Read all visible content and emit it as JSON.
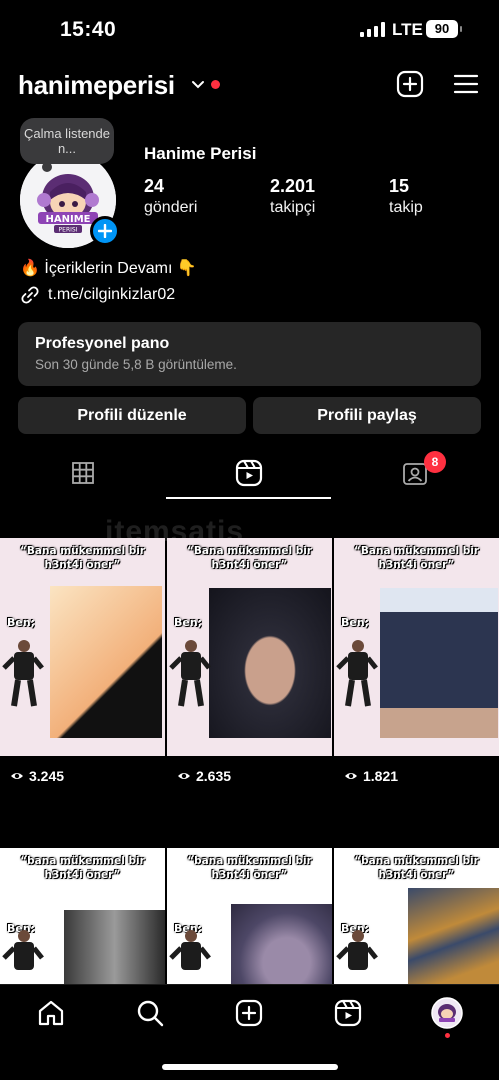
{
  "status_bar": {
    "time": "15:40",
    "network": "LTE",
    "battery": "90"
  },
  "header": {
    "username": "hanimeperisi",
    "icons": [
      "chevron-down-icon",
      "new-post-icon",
      "menu-icon"
    ]
  },
  "note": {
    "text": "Çalma listende n..."
  },
  "avatar": {
    "logo_text": "HANIME",
    "logo_sub": "PERISI"
  },
  "profile": {
    "display_name": "Hanime Perisi",
    "stats": [
      {
        "value": "24",
        "label": "gönderi"
      },
      {
        "value": "2.201",
        "label": "takipçi"
      },
      {
        "value": "15",
        "label": "takip"
      }
    ],
    "bio": "🔥 İçeriklerin Devamı 👇",
    "link": "t.me/cilginkizlar02"
  },
  "dashboard": {
    "title": "Profesyonel pano",
    "subtitle": "Son 30 günde 5,8 B görüntüleme."
  },
  "buttons": {
    "edit": "Profili düzenle",
    "share": "Profili paylaş"
  },
  "tabs": {
    "tagged_badge": "8"
  },
  "watermark": "itemsatis",
  "posts": [
    {
      "caption": "“Bana mükemmel bir h3nt4i öner”",
      "ben": "Ben;",
      "views": "3.245"
    },
    {
      "caption": "“Bana mükemmel bir h3nt4i öner”",
      "ben": "Ben;",
      "views": "2.635"
    },
    {
      "caption": "“Bana mükemmel bir h3nt4i öner”",
      "ben": "Ben;",
      "views": "1.821"
    },
    {
      "caption": "“bana mükemmel bir h3nt4i öner”",
      "ben": "Ben:"
    },
    {
      "caption": "“bana mükemmel bir h3nt4i öner”",
      "ben": "Ben:"
    },
    {
      "caption": "“bana mükemmel bir h3nt4i öner”",
      "ben": "Ben:"
    }
  ],
  "colors": {
    "accent_blue": "#0095f6",
    "notification_red": "#ff3040",
    "button_bg": "#262626"
  }
}
